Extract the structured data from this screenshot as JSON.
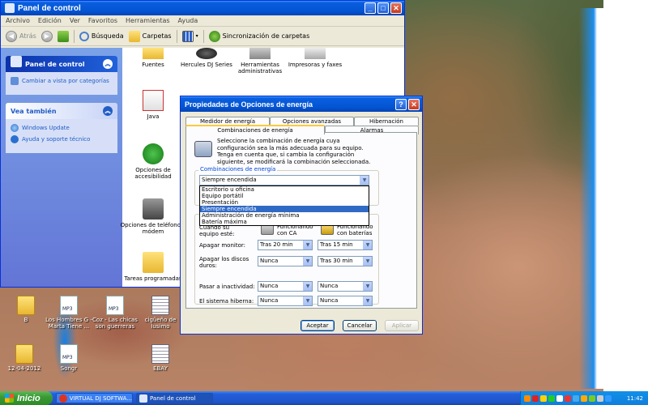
{
  "control_panel": {
    "title": "Panel de control",
    "menu": [
      "Archivo",
      "Edición",
      "Ver",
      "Favoritos",
      "Herramientas",
      "Ayuda"
    ],
    "toolbar": {
      "back": "Atrás",
      "search": "Búsqueda",
      "folders": "Carpetas",
      "sync": "Sincronización de carpetas"
    },
    "task_pane": {
      "panel_header": "Panel de control",
      "switch_view": "Cambiar a vista por categorías",
      "see_also_header": "Vea también",
      "see_also": [
        "Windows Update",
        "Ayuda y soporte técnico"
      ]
    },
    "items": {
      "fuentes": "Fuentes",
      "hercules": "Hercules DJ Series",
      "admin_tools": "Herramientas administrativas",
      "printers": "Impresoras y faxes",
      "java": "Java",
      "accessibility": "Opciones de accesibilidad",
      "phone_modem": "Opciones de teléfono y módem",
      "scheduled": "Tareas programadas"
    }
  },
  "dialog": {
    "title": "Propiedades de Opciones de energía",
    "tabs": [
      "Medidor de energía",
      "Opciones avanzadas",
      "Hibernación",
      "Combinaciones de energía",
      "Alarmas"
    ],
    "active_tab": "Combinaciones de energía",
    "intro": "Seleccione la combinación de energía cuya configuración sea la más adecuada para su equipo. Tenga en cuenta que, si cambia la configuración siguiente, se modificará la combinación seleccionada.",
    "group_label": "Combinaciones de energía",
    "selected_scheme": "Siempre encendida",
    "scheme_options": [
      "Escritorio u oficina",
      "Equipo portátil",
      "Presentación",
      "Siempre encendida",
      "Administración de energía mínima",
      "Batería máxima"
    ],
    "settings_caption": "Cuando su equipo esté:",
    "col_ac": "Funcionando con CA",
    "col_battery": "Funcionando con baterías",
    "rows": [
      {
        "label": "Apagar monitor:",
        "ac": "Tras 20 min",
        "battery": "Tras 15 min"
      },
      {
        "label": "Apagar los discos duros:",
        "ac": "Nunca",
        "battery": "Tras 30 min"
      },
      {
        "label": "Pasar a inactividad:",
        "ac": "Nunca",
        "battery": "Nunca"
      },
      {
        "label": "El sistema hiberna:",
        "ac": "Nunca",
        "battery": "Nunca"
      }
    ],
    "buttons": {
      "ok": "Aceptar",
      "cancel": "Cancelar",
      "apply": "Aplicar"
    }
  },
  "desktop_icons": [
    {
      "label": "B"
    },
    {
      "label": "Los Hombres G - Marta Tiene ..."
    },
    {
      "label": "Coz - Las chicas son guerreras"
    },
    {
      "label": "cigüeño de lusimo"
    },
    {
      "label": "12-04-2012"
    },
    {
      "label": "Songr"
    },
    {
      "label": "EBAY"
    }
  ],
  "taskbar": {
    "start": "Inicio",
    "buttons": [
      "VIRTUAL DJ SOFTWA...",
      "Panel de control"
    ],
    "clock": "11:42"
  }
}
